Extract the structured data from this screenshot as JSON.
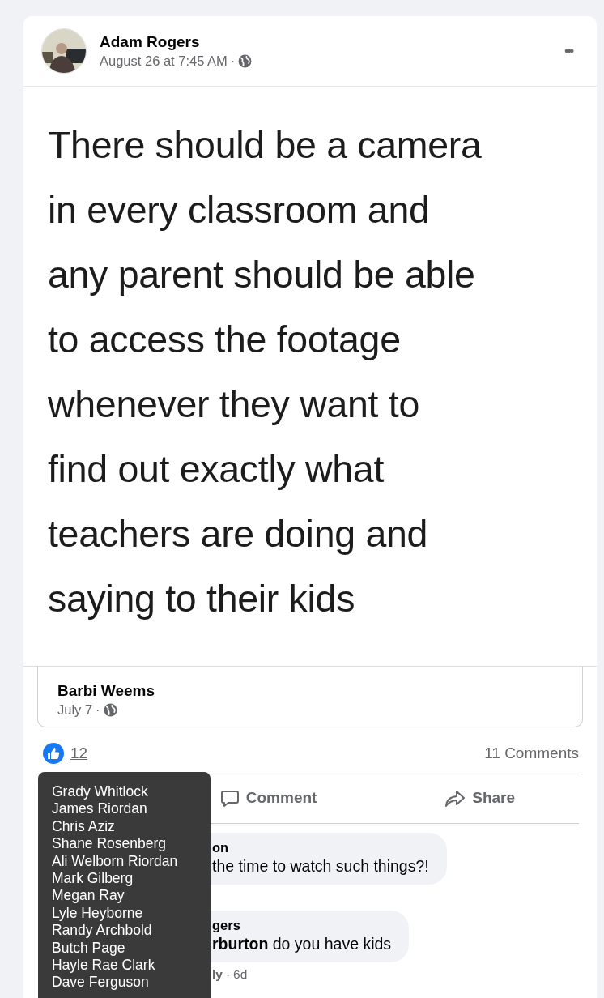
{
  "post": {
    "author": "Adam Rogers",
    "time": "August 26 at 7:45 AM",
    "dot": "·",
    "more": "•••",
    "image_text": [
      "There should be a camera",
      "in every classroom and",
      "any parent should be able",
      "to access the footage",
      "whenever they want to",
      "find out exactly what",
      "teachers are doing and",
      "saying to their kids"
    ],
    "shared_from": {
      "author": "Barbi Weems",
      "time": "July 7",
      "dot": "·"
    },
    "reaction_count": "12",
    "comment_count": "11 Comments",
    "actions": [
      {
        "kind": "comment",
        "label": "Comment"
      },
      {
        "kind": "share",
        "label": "Share"
      }
    ]
  },
  "comments": [
    {
      "author": "on",
      "text": "the time to watch such things?!",
      "children": [
        {
          "author": "gers",
          "text": "**rburton** do you have kids",
          "meta": [
            {
              "kind": "link",
              "text": "ly"
            },
            {
              "kind": "dot",
              "text": "·"
            },
            {
              "kind": "time",
              "text": "6d"
            }
          ]
        }
      ]
    }
  ],
  "tooltip": {
    "names": [
      "Grady Whitlock",
      "James Riordan",
      "Chris Aziz",
      "Shane Rosenberg",
      "Ali Welborn Riordan",
      "Mark Gilberg",
      "Megan Ray",
      "Lyle Heyborne",
      "Randy Archbold",
      "Butch Page",
      "Hayle Rae Clark",
      "Dave Ferguson"
    ]
  }
}
